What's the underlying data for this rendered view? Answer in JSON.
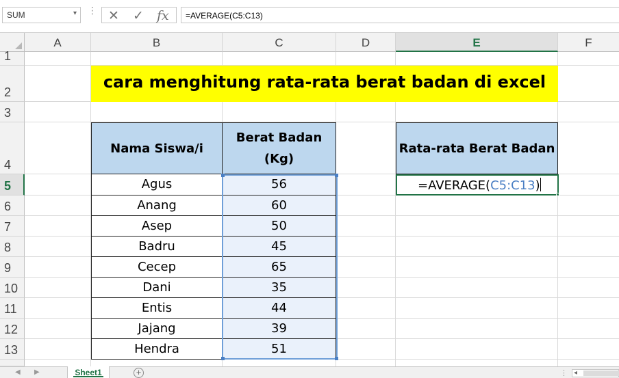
{
  "formula_bar": {
    "name_box": "SUM",
    "cancel_icon": "✕",
    "enter_icon": "✓",
    "fx_label": "fx",
    "formula": "=AVERAGE(C5:C13)"
  },
  "columns": [
    "A",
    "B",
    "C",
    "D",
    "E",
    "F"
  ],
  "selected_column": "E",
  "rows": [
    "1",
    "2",
    "3",
    "4",
    "5",
    "6",
    "7",
    "8",
    "9",
    "10",
    "11",
    "12",
    "13"
  ],
  "selected_row": "5",
  "sheet": {
    "title": "cara menghitung rata-rata berat badan di excel",
    "table_header": {
      "name_col": "Nama Siswa/i",
      "weight_col_line1": "Berat Badan",
      "weight_col_line2": "(Kg)"
    },
    "students": [
      {
        "name": "Agus",
        "weight": "56"
      },
      {
        "name": "Anang",
        "weight": "60"
      },
      {
        "name": "Asep",
        "weight": "50"
      },
      {
        "name": "Badru",
        "weight": "45"
      },
      {
        "name": "Cecep",
        "weight": "65"
      },
      {
        "name": "Dani",
        "weight": "35"
      },
      {
        "name": "Entis",
        "weight": "44"
      },
      {
        "name": "Jajang",
        "weight": "39"
      },
      {
        "name": "Hendra",
        "weight": "51"
      }
    ],
    "avg_header": "Rata-rata Berat Badan",
    "active_cell": {
      "prefix": "=AVERAGE(",
      "range": "C5:C13",
      "suffix": ")"
    }
  },
  "tabs": {
    "active": "Sheet1",
    "add_icon": "+"
  },
  "colors": {
    "title_fill": "#ffff00",
    "header_fill": "#bdd7ee",
    "range_highlight": "#6f9fd8",
    "excel_green": "#217346"
  }
}
